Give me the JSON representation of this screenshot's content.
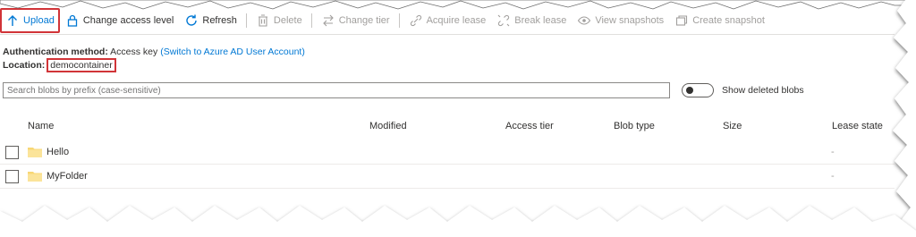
{
  "toolbar": {
    "upload": "Upload",
    "change_access_level": "Change access level",
    "refresh": "Refresh",
    "delete": "Delete",
    "change_tier": "Change tier",
    "acquire_lease": "Acquire lease",
    "break_lease": "Break lease",
    "view_snapshots": "View snapshots",
    "create_snapshot": "Create snapshot"
  },
  "auth": {
    "label": "Authentication method:",
    "value": "Access key",
    "link": "(Switch to Azure AD User Account)"
  },
  "location": {
    "label": "Location:",
    "value": "democontainer"
  },
  "search": {
    "placeholder": "Search blobs by prefix (case-sensitive)"
  },
  "show_deleted": {
    "label": "Show deleted blobs",
    "enabled": false
  },
  "table": {
    "columns": [
      "Name",
      "Modified",
      "Access tier",
      "Blob type",
      "Size",
      "Lease state"
    ],
    "rows": [
      {
        "name": "Hello",
        "lease_state": "-"
      },
      {
        "name": "MyFolder",
        "lease_state": "-"
      }
    ]
  },
  "colors": {
    "accent": "#0078d4",
    "highlight": "#d13438",
    "folder": "#f8d775"
  }
}
